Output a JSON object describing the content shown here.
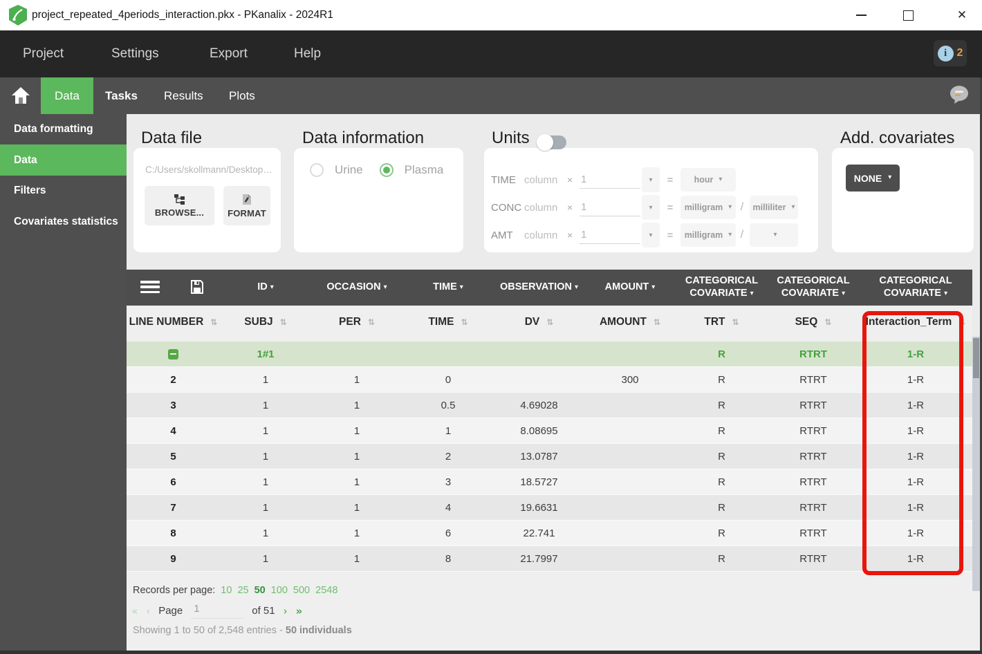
{
  "window": {
    "title": "project_repeated_4periods_interaction.pkx - PKanalix - 2024R1"
  },
  "menubar": {
    "items": [
      "Project",
      "Settings",
      "Export",
      "Help"
    ],
    "info_badge_count": "2"
  },
  "tabbar": {
    "tabs": [
      "Data",
      "Tasks",
      "Results",
      "Plots"
    ],
    "active_tab": "Data"
  },
  "sidebar": {
    "items": [
      "Data formatting",
      "Data",
      "Filters",
      "Covariates statistics"
    ],
    "active_item": "Data"
  },
  "panels": {
    "data_file": {
      "title": "Data file",
      "path": "C:/Users/skollmann/Desktop…",
      "browse_label": "BROWSE...",
      "format_label": "FORMAT"
    },
    "data_information": {
      "title": "Data information",
      "options": [
        "Urine",
        "Plasma"
      ],
      "selected": "Plasma"
    },
    "units": {
      "title": "Units",
      "toggle_state": "off",
      "column_label": "column",
      "times_symbol": "×",
      "equals_symbol": "=",
      "slash_symbol": "/",
      "rows": [
        {
          "label": "TIME",
          "factor": "1",
          "numerator": "hour",
          "denominator": null
        },
        {
          "label": "CONC",
          "factor": "1",
          "numerator": "milligram",
          "denominator": "milliliter"
        },
        {
          "label": "AMT",
          "factor": "1",
          "numerator": "milligram",
          "denominator": ""
        }
      ]
    },
    "add_covariates": {
      "title": "Add. covariates",
      "button_label": "NONE"
    }
  },
  "table": {
    "toolbar_icons": [
      "hamburger-menu-icon",
      "save-icon"
    ],
    "toolbar_headers": [
      "ID",
      "OCCASION",
      "TIME",
      "OBSERVATION",
      "AMOUNT",
      "CATEGORICAL COVARIATE",
      "CATEGORICAL COVARIATE",
      "CATEGORICAL COVARIATE"
    ],
    "column_headers": [
      "LINE NUMBER",
      "SUBJ",
      "PER",
      "TIME",
      "DV",
      "AMOUNT",
      "TRT",
      "SEQ",
      "Interaction_Term"
    ],
    "group_row": {
      "collapse_icon": "minus-icon",
      "cells": [
        "",
        "1#1",
        "",
        "",
        "",
        "",
        "R",
        "RTRT",
        "1-R"
      ]
    },
    "rows": [
      [
        "2",
        "1",
        "1",
        "0",
        "",
        "300",
        "R",
        "RTRT",
        "1-R"
      ],
      [
        "3",
        "1",
        "1",
        "0.5",
        "4.69028",
        "",
        "R",
        "RTRT",
        "1-R"
      ],
      [
        "4",
        "1",
        "1",
        "1",
        "8.08695",
        "",
        "R",
        "RTRT",
        "1-R"
      ],
      [
        "5",
        "1",
        "1",
        "2",
        "13.0787",
        "",
        "R",
        "RTRT",
        "1-R"
      ],
      [
        "6",
        "1",
        "1",
        "3",
        "18.5727",
        "",
        "R",
        "RTRT",
        "1-R"
      ],
      [
        "7",
        "1",
        "1",
        "4",
        "19.6631",
        "",
        "R",
        "RTRT",
        "1-R"
      ],
      [
        "8",
        "1",
        "1",
        "6",
        "22.741",
        "",
        "R",
        "RTRT",
        "1-R"
      ],
      [
        "9",
        "1",
        "1",
        "8",
        "21.7997",
        "",
        "R",
        "RTRT",
        "1-R"
      ]
    ],
    "highlighted_column": "Interaction_Term",
    "highlight_color": "#e9150b"
  },
  "footer": {
    "records_label": "Records per page:",
    "per_page_options": [
      "10",
      "25",
      "50",
      "100",
      "500",
      "2548"
    ],
    "per_page_selected": "50",
    "first_symbol": "«",
    "prev_symbol": "‹",
    "page_label": "Page",
    "page_value": "1",
    "of_label": "of 51",
    "next_symbol": "›",
    "last_symbol": "»",
    "showing_text": "Showing 1 to 50 of 2,548 entries - ",
    "individuals_text": "50 individuals"
  },
  "colors": {
    "accent_green": "#5cb85c",
    "dark_gray": "#4f4f4f",
    "menubar_dark": "#262626",
    "group_row_green": "#d6e4cd",
    "highlight_red": "#e9150b"
  }
}
